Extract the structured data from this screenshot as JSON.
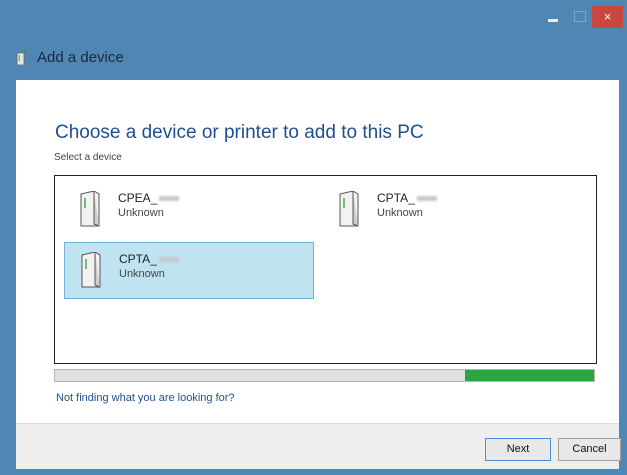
{
  "window": {
    "title": "Add a device",
    "buttons": {
      "minimize": "–",
      "maximize": "□",
      "close": "×"
    }
  },
  "main": {
    "heading": "Choose a device or printer to add to this PC",
    "subheading": "Select a device",
    "devices": [
      {
        "name": "CPEA_",
        "status": "Unknown",
        "selected": false,
        "icon": "computer-tower-icon"
      },
      {
        "name": "CPTA_",
        "status": "Unknown",
        "selected": false,
        "icon": "computer-tower-icon"
      },
      {
        "name": "CPTA_",
        "status": "Unknown",
        "selected": true,
        "icon": "computer-tower-icon"
      }
    ],
    "search_progress": {
      "animating": true,
      "segment_start": 0.76,
      "segment_end": 1.0
    },
    "help_link": "Not finding what you are looking for?"
  },
  "footer": {
    "next_label": "Next",
    "cancel_label": "Cancel"
  },
  "colors": {
    "titlebar": "#4f86b3",
    "close_button": "#c8473f",
    "heading": "#1f4f8f",
    "selection": "#bfe3f1",
    "progress": "#2fa33f"
  }
}
